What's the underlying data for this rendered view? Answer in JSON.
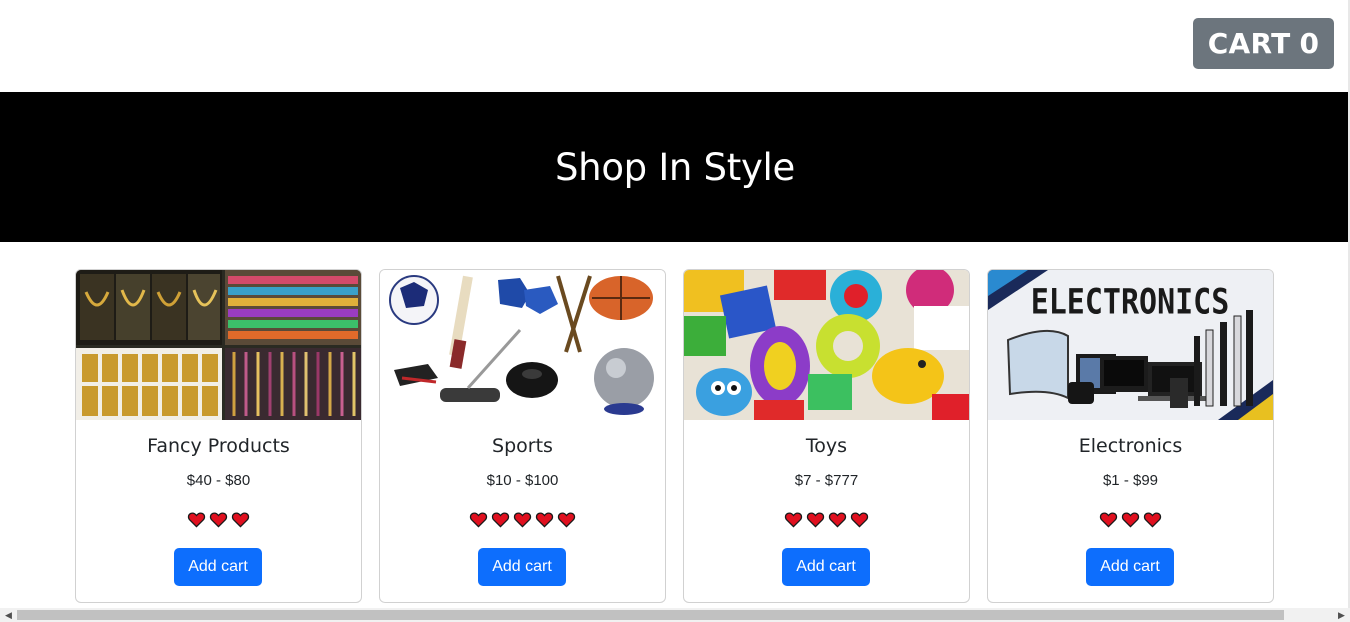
{
  "header": {
    "cart_label": "CART",
    "cart_count": "0"
  },
  "hero": {
    "title": "Shop In Style"
  },
  "products": [
    {
      "name": "Fancy Products",
      "price": "$40 - $80",
      "rating": 3,
      "button": "Add cart",
      "image": "jewelry-bangles-shop-photo"
    },
    {
      "name": "Sports",
      "price": "$10 - $100",
      "rating": 5,
      "button": "Add cart",
      "image": "sports-equipment-photo"
    },
    {
      "name": "Toys",
      "price": "$7 - $777",
      "rating": 4,
      "button": "Add cart",
      "image": "colorful-toys-photo"
    },
    {
      "name": "Electronics",
      "price": "$1 - $99",
      "rating": 3,
      "button": "Add cart",
      "image": "electronics-banner-image",
      "image_text": "ELECTRONICS"
    }
  ],
  "colors": {
    "cart_button": "#6c757d",
    "hero_bg": "#000000",
    "add_button": "#0d6efd",
    "heart": "#e0101f"
  },
  "icons": {
    "rating": "heart-icon",
    "scroll_left": "scroll-left-arrow-icon",
    "scroll_right": "scroll-right-arrow-icon"
  }
}
